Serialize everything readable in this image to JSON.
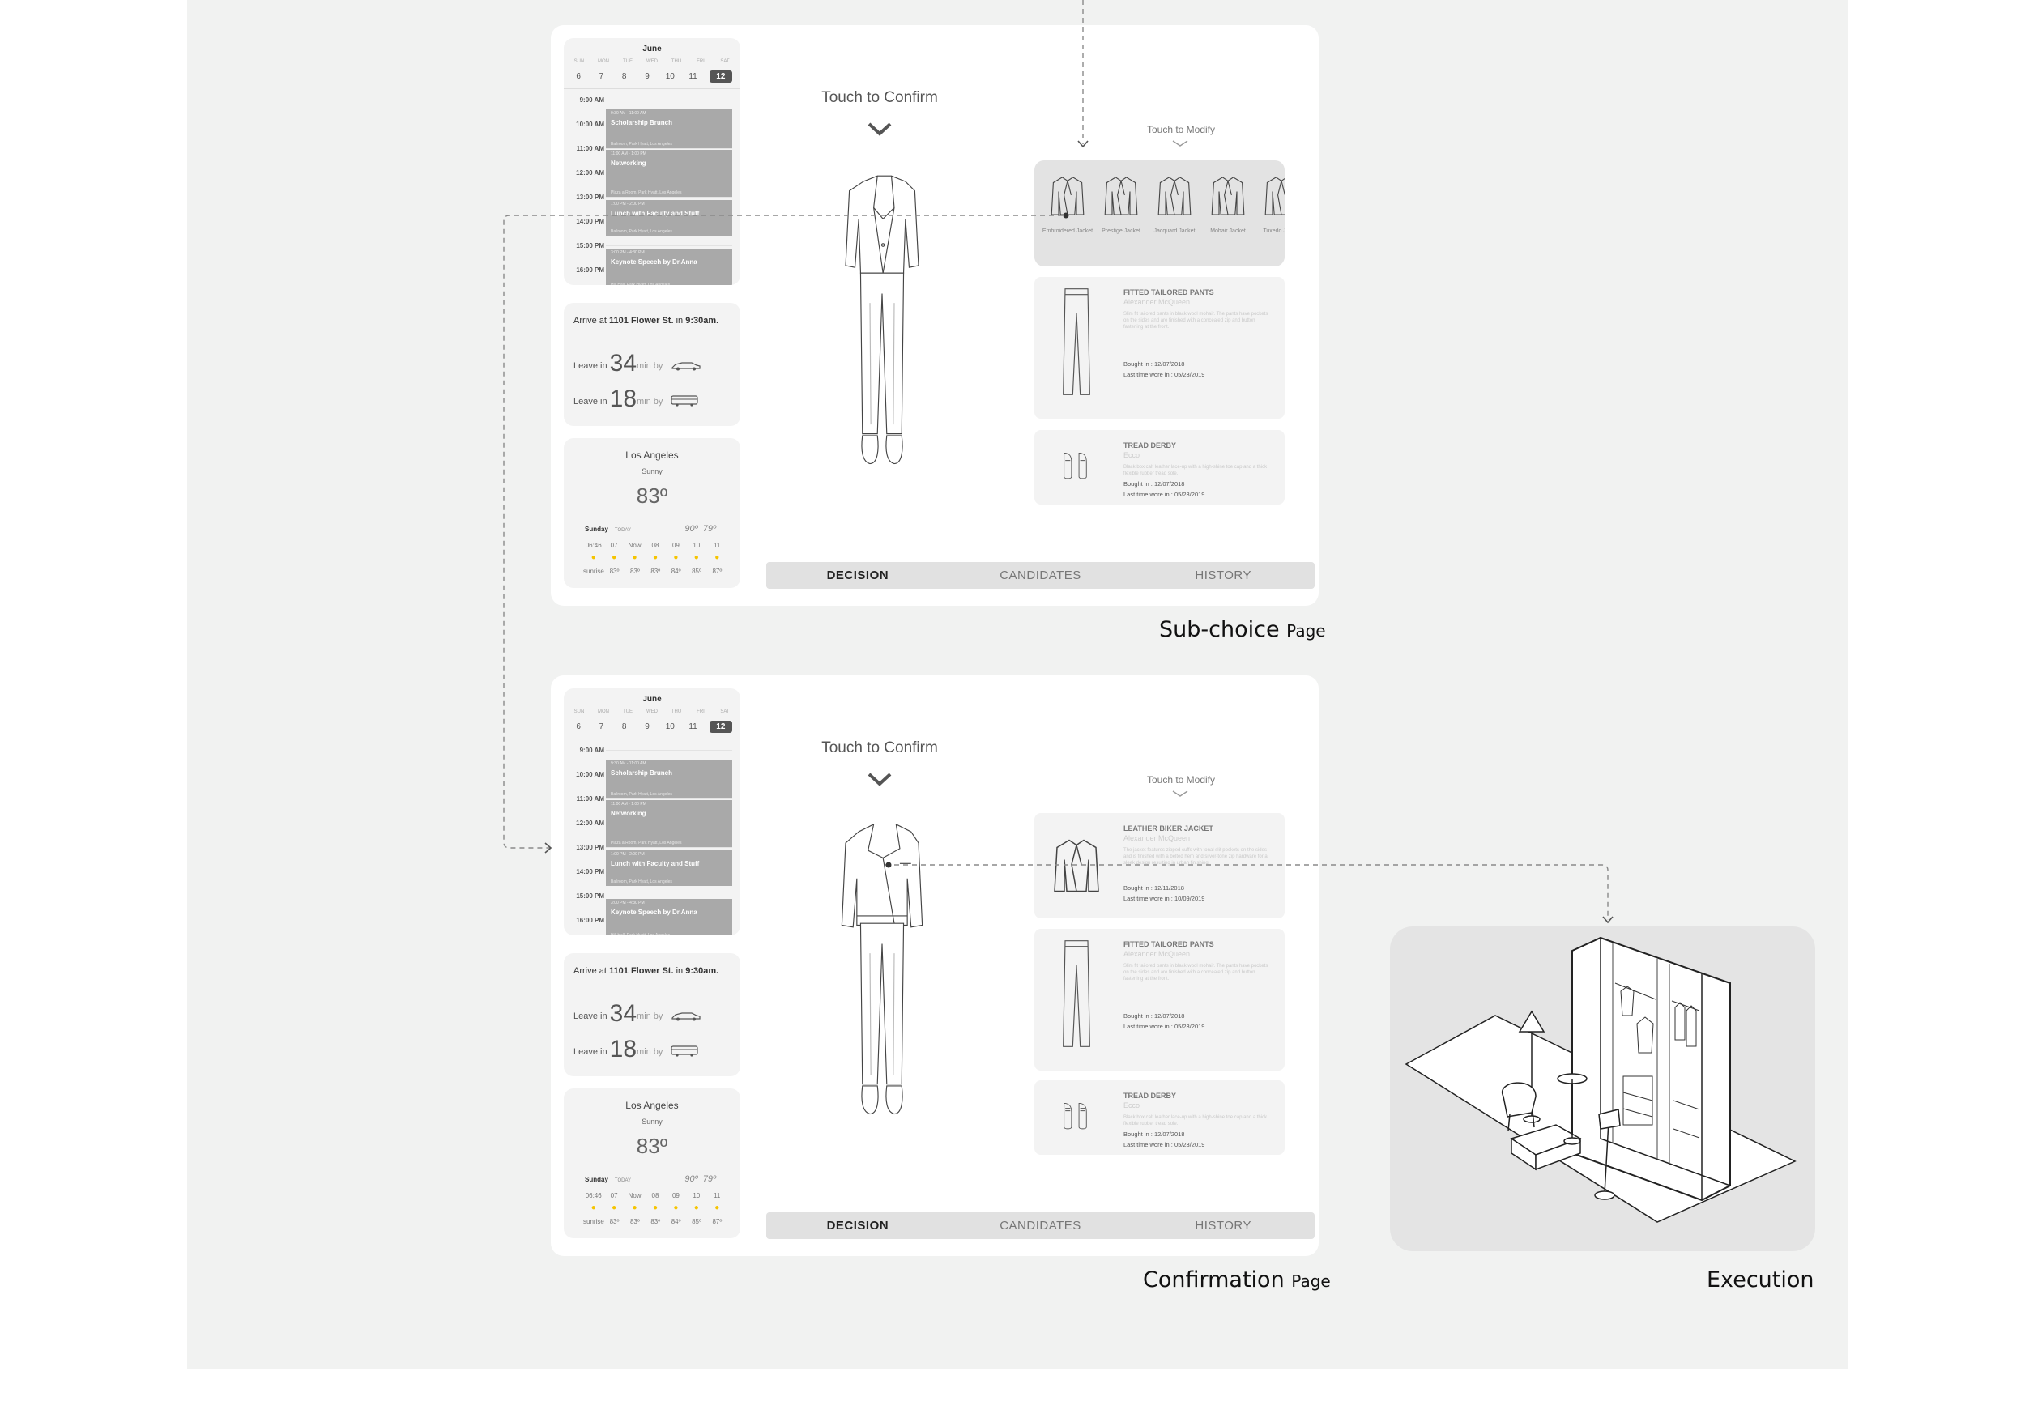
{
  "screens": [
    {
      "caption": "Sub-choice",
      "caption_suffix": "Page",
      "calendar": {
        "month": "June",
        "weekdays": [
          "SUN",
          "MON",
          "TUE",
          "WED",
          "THU",
          "FRI",
          "SAT"
        ],
        "days": [
          "6",
          "7",
          "8",
          "9",
          "10",
          "11",
          "12"
        ],
        "selected_day": "12",
        "times": [
          "9:00 AM",
          "10:00 AM",
          "11:00 AM",
          "12:00 AM",
          "13:00 PM",
          "14:00 PM",
          "15:00 PM",
          "16:00 PM"
        ],
        "events": [
          {
            "time": "9:30 AM - 11:00 AM",
            "title": "Scholarship Brunch",
            "location": "Ballroom, Park Hyatt, Los Angeles"
          },
          {
            "time": "11:00 AM - 1:00 PM",
            "title": "Networking",
            "location": "Plaza a Room, Park Hyatt, Los Angeles"
          },
          {
            "time": "1:00 PM - 2:00 PM",
            "title": "Lunch with Faculty and Stuff",
            "location": "Ballroom, Park Hyatt, Los Angeles"
          },
          {
            "time": "3:00 PM - 4:30 PM",
            "title": "Keynote Speech by Dr.Anna",
            "location": "Hill Hall, Park Hyatt, Los Angeles"
          }
        ]
      },
      "arrival": {
        "arrive_prefix": "Arrive at",
        "address": "1101 Flower St.",
        "in_word": "in",
        "time": "9:30am.",
        "leave_label": "Leave in",
        "car_minutes": "34",
        "transit_minutes": "18",
        "min_by": "min by"
      },
      "weather": {
        "city": "Los Angeles",
        "condition": "Sunny",
        "temp": "83º",
        "day": "Sunday",
        "today": "TODAY",
        "high": "90º",
        "low": "79º",
        "hours": [
          "06:46",
          "07",
          "Now",
          "08",
          "09",
          "10",
          "11"
        ],
        "temps": [
          "sunrise",
          "83º",
          "83º",
          "83º",
          "84º",
          "85º",
          "87º"
        ]
      },
      "touch_confirm": "Touch to Confirm",
      "touch_modify": "Touch to Modify",
      "candidates": [
        {
          "name": "Embroidered Jacket"
        },
        {
          "name": "Prestige Jacket"
        },
        {
          "name": "Jacquard Jacket"
        },
        {
          "name": "Mohair Jacket"
        },
        {
          "name": "Tuxedo Jacket"
        }
      ],
      "cards": [
        {
          "title": "FITTED TAILORED PANTS",
          "brand": "Alexander McQueen",
          "desc": "Slim fit tailored pants in black wool mohair. The pants have pockets on the sides and are finished with a concealed zip and button fastening at the front.",
          "bought": "Bought in : 12/07/2018",
          "worn": "Last time wore in : 05/23/2019",
          "icon": "pants-icon"
        },
        {
          "title": "TREAD DERBY",
          "brand": "Ecco",
          "desc": "Black box calf leather lace-up with a high-shine toe cap and a thick flexible rubber tread sole.",
          "bought": "Bought in : 12/07/2018",
          "worn": "Last time wore in : 05/23/2019",
          "icon": "shoes-icon"
        }
      ],
      "tabs": [
        "DECISION",
        "CANDIDATES",
        "HISTORY"
      ]
    },
    {
      "caption": "Confirmation",
      "caption_suffix": "Page",
      "touch_confirm": "Touch to Confirm",
      "touch_modify": "Touch to Modify",
      "cards": [
        {
          "title": "LEATHER BIKER JACKET",
          "brand": "Alexander McQueen",
          "desc": "The jacket features zipped cuffs with tonal slit pockets on the sides and is finished with a belted hem and silver-tone zip hardware for a sleek design resulting in urban finishing.",
          "bought": "Bought in : 12/11/2018",
          "worn": "Last time wore in : 10/09/2019",
          "icon": "jacket-icon"
        },
        {
          "title": "FITTED TAILORED PANTS",
          "brand": "Alexander McQueen",
          "desc": "Slim fit tailored pants in black wool mohair. The pants have pockets on the sides and are finished with a concealed zip and button fastening at the front.",
          "bought": "Bought in : 12/07/2018",
          "worn": "Last time wore in : 05/23/2019",
          "icon": "pants-icon"
        },
        {
          "title": "TREAD DERBY",
          "brand": "Ecco",
          "desc": "Black box calf leather lace-up with a high-shine toe cap and a thick flexible rubber tread sole.",
          "bought": "Bought in : 12/07/2018",
          "worn": "Last time wore in : 05/23/2019",
          "icon": "shoes-icon"
        }
      ],
      "tabs": [
        "DECISION",
        "CANDIDATES",
        "HISTORY"
      ]
    }
  ],
  "execution": {
    "caption": "Execution",
    "icon": "wardrobe-illustration"
  }
}
